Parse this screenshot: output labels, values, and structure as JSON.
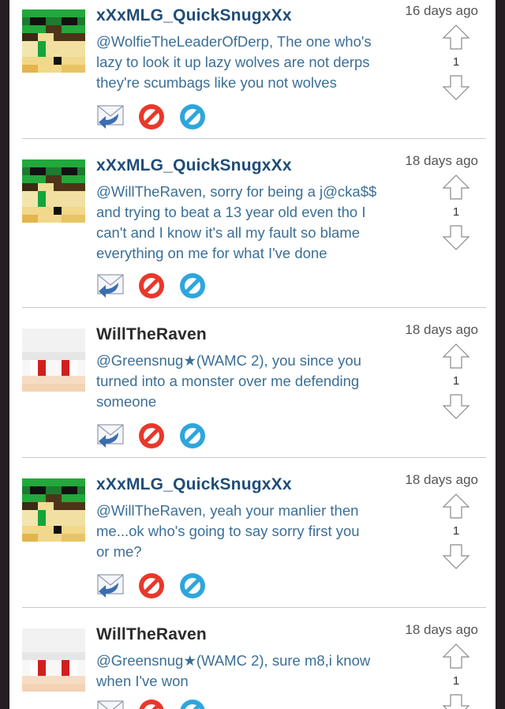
{
  "comments": [
    {
      "user": "xXxMLG_QuickSnugxXx",
      "time": "16 days ago",
      "score": "1",
      "lines": [
        "@WolfieTheLeaderOfDerp, The one who's",
        "lazy to look it up lazy wolves are not derps",
        "they're scumbags like you not wolves"
      ]
    },
    {
      "user": "xXxMLG_QuickSnugxXx",
      "time": "18 days ago",
      "score": "1",
      "lines": [
        "@WillTheRaven, sorry for being a j@cka$$",
        "and trying to beat a 13 year old even tho I",
        "can't and I know it's all my fault so blame",
        "everything on me for what I've done"
      ]
    },
    {
      "user": "WillTheRaven",
      "time": "18 days ago",
      "score": "1",
      "lines": [
        "@Greensnug★(WAMC 2), you since you",
        "turned into a monster over me defending",
        "someone"
      ]
    },
    {
      "user": "xXxMLG_QuickSnugxXx",
      "time": "18 days ago",
      "score": "1",
      "lines": [
        "@WillTheRaven, yeah your manlier then",
        "me...ok who's going to say sorry first you",
        "or me?"
      ]
    },
    {
      "user": "WillTheRaven",
      "time": "18 days ago",
      "score": "1",
      "lines": [
        "@Greensnug★(WAMC 2), sure m8,i know",
        "when I've won"
      ]
    }
  ],
  "colors": {
    "mlg_name": "#1f4d78",
    "raven_name": "#2a2a2a",
    "body_text": "#3b6f96",
    "reply": "#3a6db0",
    "flag": "#e8382b",
    "block": "#2ea6dc"
  }
}
